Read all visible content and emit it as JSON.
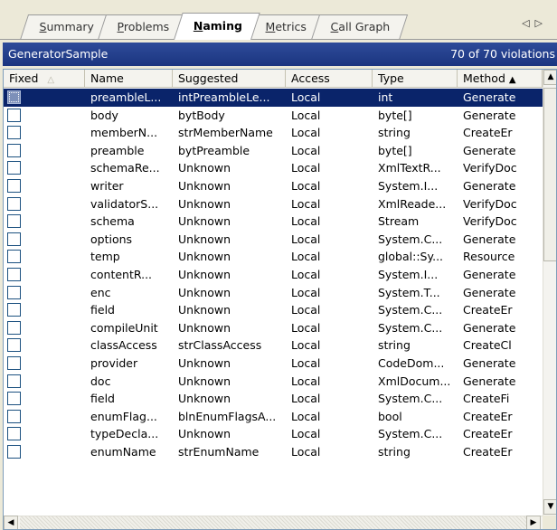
{
  "tabs": [
    {
      "label": "Summary",
      "active": false
    },
    {
      "label": "Problems",
      "active": false
    },
    {
      "label": "Naming",
      "active": true
    },
    {
      "label": "Metrics",
      "active": false
    },
    {
      "label": "Call Graph",
      "active": false
    }
  ],
  "tab_nav": {
    "prev": "◁",
    "next": "▷"
  },
  "header": {
    "project": "GeneratorSample",
    "violations": "70 of 70 violations"
  },
  "columns": [
    {
      "key": "fixed",
      "label": "Fixed"
    },
    {
      "key": "name",
      "label": "Name"
    },
    {
      "key": "suggested",
      "label": "Suggested"
    },
    {
      "key": "access",
      "label": "Access"
    },
    {
      "key": "type",
      "label": "Type"
    },
    {
      "key": "method",
      "label": "Method"
    }
  ],
  "rows": [
    {
      "name": "preambleL...",
      "suggested": "intPreambleLe...",
      "access": "Local",
      "type": "int",
      "method": "Generate",
      "selected": true
    },
    {
      "name": "body",
      "suggested": "bytBody",
      "access": "Local",
      "type": "byte[]",
      "method": "Generate"
    },
    {
      "name": "memberN...",
      "suggested": "strMemberName",
      "access": "Local",
      "type": "string",
      "method": "CreateEr"
    },
    {
      "name": "preamble",
      "suggested": "bytPreamble",
      "access": "Local",
      "type": "byte[]",
      "method": "Generate"
    },
    {
      "name": "schemaRe...",
      "suggested": "Unknown",
      "access": "Local",
      "type": "XmlTextR...",
      "method": "VerifyDoc"
    },
    {
      "name": "writer",
      "suggested": "Unknown",
      "access": "Local",
      "type": "System.I...",
      "method": "Generate"
    },
    {
      "name": "validatorS...",
      "suggested": "Unknown",
      "access": "Local",
      "type": "XmlReade...",
      "method": "VerifyDoc"
    },
    {
      "name": "schema",
      "suggested": "Unknown",
      "access": "Local",
      "type": "Stream",
      "method": "VerifyDoc"
    },
    {
      "name": "options",
      "suggested": "Unknown",
      "access": "Local",
      "type": "System.C...",
      "method": "Generate"
    },
    {
      "name": "temp",
      "suggested": "Unknown",
      "access": "Local",
      "type": "global::Sy...",
      "method": "Resource"
    },
    {
      "name": "contentR...",
      "suggested": "Unknown",
      "access": "Local",
      "type": "System.I...",
      "method": "Generate"
    },
    {
      "name": "enc",
      "suggested": "Unknown",
      "access": "Local",
      "type": "System.T...",
      "method": "Generate"
    },
    {
      "name": "field",
      "suggested": "Unknown",
      "access": "Local",
      "type": "System.C...",
      "method": "CreateEr"
    },
    {
      "name": "compileUnit",
      "suggested": "Unknown",
      "access": "Local",
      "type": "System.C...",
      "method": "Generate"
    },
    {
      "name": "classAccess",
      "suggested": "strClassAccess",
      "access": "Local",
      "type": "string",
      "method": "CreateCl"
    },
    {
      "name": "provider",
      "suggested": "Unknown",
      "access": "Local",
      "type": "CodeDom...",
      "method": "Generate"
    },
    {
      "name": "doc",
      "suggested": "Unknown",
      "access": "Local",
      "type": "XmlDocum...",
      "method": "Generate"
    },
    {
      "name": "field",
      "suggested": "Unknown",
      "access": "Local",
      "type": "System.C...",
      "method": "CreateFi"
    },
    {
      "name": "enumFlag...",
      "suggested": "blnEnumFlagsA...",
      "access": "Local",
      "type": "bool",
      "method": "CreateEr"
    },
    {
      "name": "typeDecla...",
      "suggested": "Unknown",
      "access": "Local",
      "type": "System.C...",
      "method": "CreateEr"
    },
    {
      "name": "enumName",
      "suggested": "strEnumName",
      "access": "Local",
      "type": "string",
      "method": "CreateEr"
    }
  ],
  "scrollbar": {
    "up": "▲",
    "down": "▼",
    "left": "◀",
    "right": "▶"
  },
  "colors": {
    "selection": "#0a246a",
    "header_bar": "#1b3580",
    "checkbox_border": "#1c5180"
  }
}
